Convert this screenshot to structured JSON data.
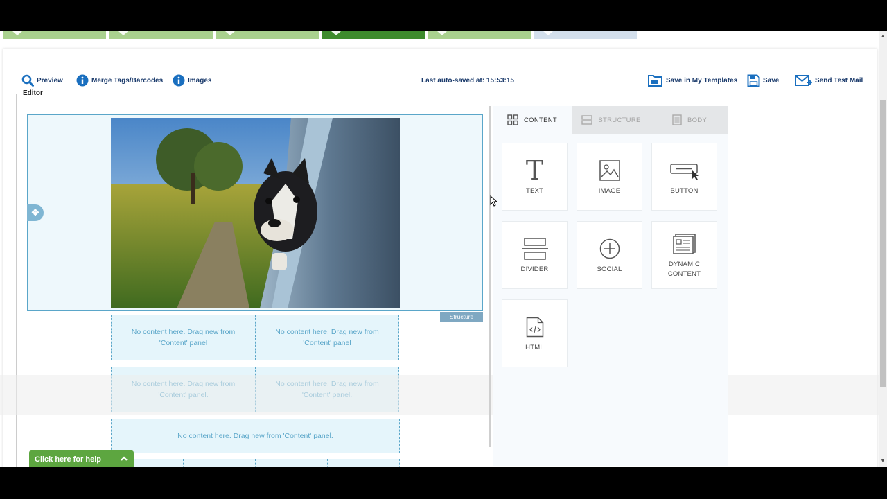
{
  "steps": [
    {
      "color": "#a9d18e"
    },
    {
      "color": "#a9d18e"
    },
    {
      "color": "#a9d18e"
    },
    {
      "color": "#3d8b2c"
    },
    {
      "color": "#a9d18e"
    },
    {
      "color": "#d3dfec"
    }
  ],
  "toolbar": {
    "preview_label": "Preview",
    "merge_tags_label": "Merge Tags/Barcodes",
    "images_label": "Images",
    "autosave_text": "Last auto-saved at: 15:53:15",
    "save_templates_label": "Save in My Templates",
    "save_label": "Save",
    "send_test_label": "Send Test Mail",
    "icon_color": "#1a6fbf"
  },
  "editor": {
    "label": "Editor",
    "structure_tag": "Structure",
    "image_alt": "Dog looking out of a car window",
    "placeholders": [
      "No content here. Drag new from 'Content' panel",
      "No content here. Drag new from 'Content' panel",
      "No content here. Drag new from 'Content' panel.",
      "No content here. Drag new from 'Content' panel.",
      "No content here. Drag new from 'Content' panel."
    ]
  },
  "panel": {
    "tabs": [
      {
        "label": "CONTENT",
        "active": true
      },
      {
        "label": "STRUCTURE",
        "active": false
      },
      {
        "label": "BODY",
        "active": false
      }
    ],
    "blocks": [
      {
        "label": "TEXT",
        "icon": "text-icon"
      },
      {
        "label": "IMAGE",
        "icon": "image-icon"
      },
      {
        "label": "BUTTON",
        "icon": "button-icon"
      },
      {
        "label": "DIVIDER",
        "icon": "divider-icon"
      },
      {
        "label": "SOCIAL",
        "icon": "social-icon"
      },
      {
        "label": "DYNAMIC CONTENT",
        "icon": "dynamic-content-icon"
      },
      {
        "label": "HTML",
        "icon": "html-icon"
      }
    ]
  },
  "help": {
    "label": "Click here for help"
  },
  "colors": {
    "accent": "#5aa6c9",
    "help_green": "#5da640",
    "nav_blue": "#1a3a6b"
  }
}
